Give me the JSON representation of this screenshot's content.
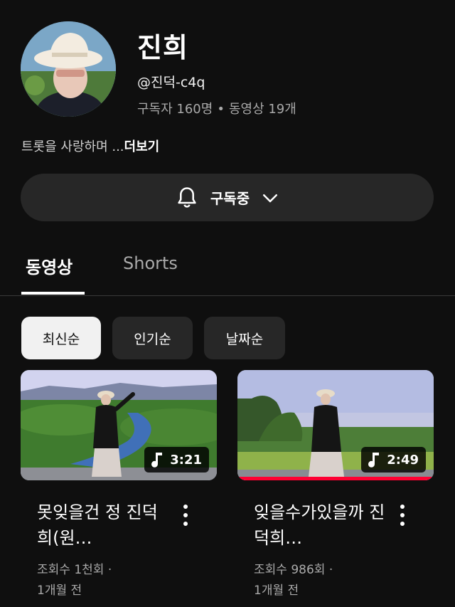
{
  "channel": {
    "name": "진희",
    "handle": "@진덕-c4q",
    "subscribers": "구독자 160명",
    "separator": "•",
    "video_count": "동영상 19개",
    "description": "트롯을 사랑하며 ...",
    "more_label": "더보기",
    "avatar_icon": "avatar-photo"
  },
  "subscribe_button": {
    "label": "구독중",
    "bell_icon": "bell-icon",
    "chevron_icon": "chevron-down-icon"
  },
  "tabs": [
    {
      "label": "동영상",
      "active": true
    },
    {
      "label": "Shorts",
      "active": false
    }
  ],
  "filters": [
    {
      "label": "최신순",
      "active": true
    },
    {
      "label": "인기순",
      "active": false
    },
    {
      "label": "날짜순",
      "active": false
    }
  ],
  "videos": [
    {
      "title": "못잊을건 정 진덕희(원…",
      "duration": "3:21",
      "views": "조회수 1천회 ·",
      "age": "1개월 전",
      "watched_fraction": 0
    },
    {
      "title": "잊을수가있을까 진덕희…",
      "duration": "2:49",
      "views": "조회수 986회 ·",
      "age": "1개월 전",
      "watched_fraction": 1.0
    }
  ],
  "colors": {
    "background": "#0f0f0f",
    "surface": "#272727",
    "progress": "#ff0033",
    "secondary_text": "#aaaaaa"
  }
}
